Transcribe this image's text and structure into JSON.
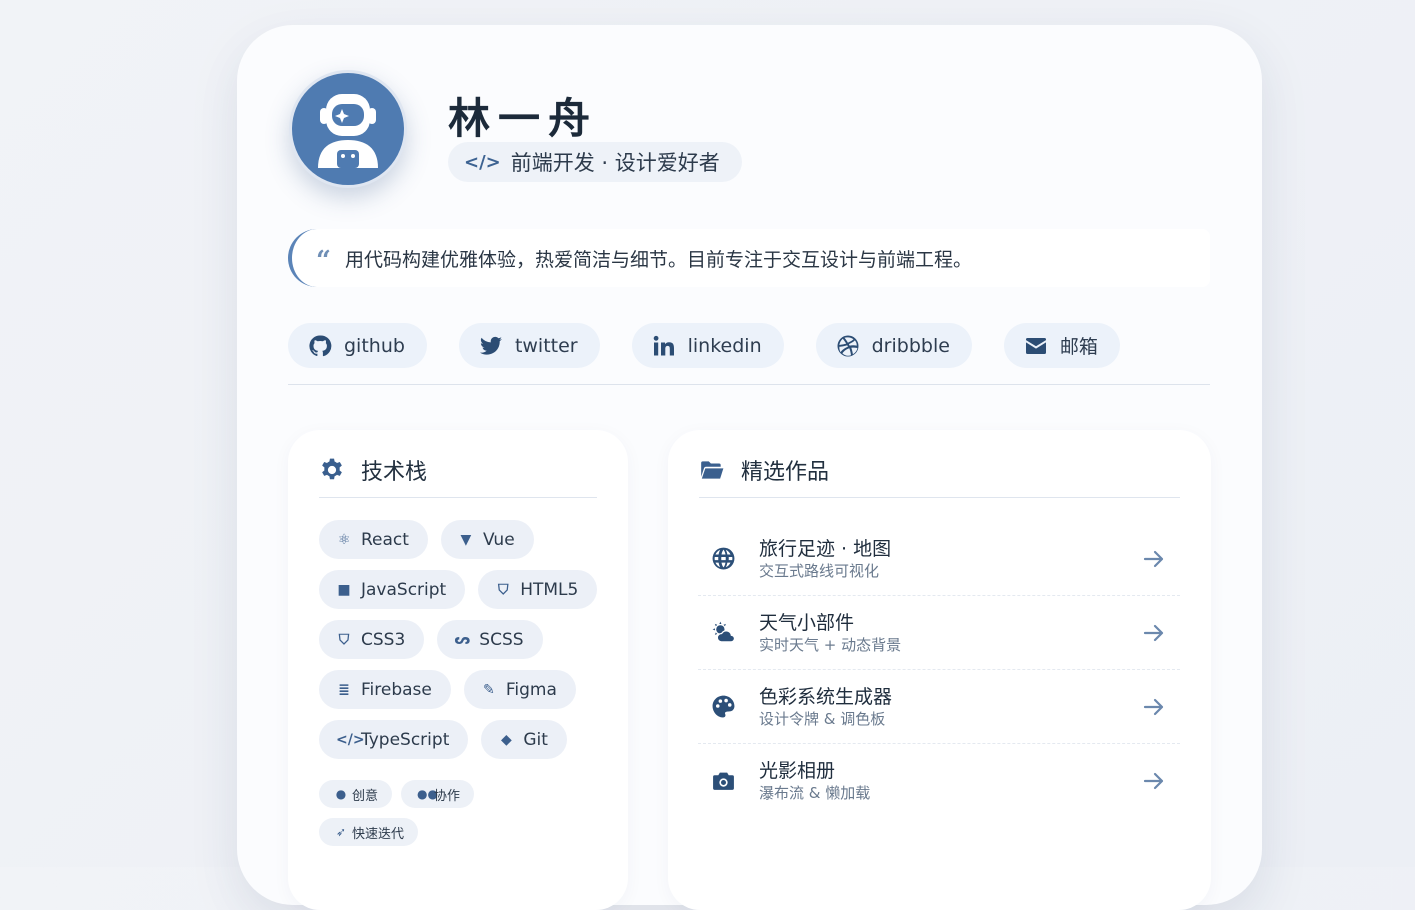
{
  "profile": {
    "name": "林一舟",
    "role": "前端开发 · 设计爱好者",
    "quote": "用代码构建优雅体验，热爱简洁与细节。目前专注于交互设计与前端工程。"
  },
  "socials": [
    {
      "label": "github",
      "icon": "github-icon"
    },
    {
      "label": "twitter",
      "icon": "twitter-icon"
    },
    {
      "label": "linkedin",
      "icon": "linkedin-icon"
    },
    {
      "label": "dribbble",
      "icon": "dribbble-icon"
    },
    {
      "label": "邮箱",
      "icon": "mail-icon"
    }
  ],
  "tech": {
    "title": "技术栈",
    "tags": [
      {
        "label": "React",
        "icon": "react-icon"
      },
      {
        "label": "Vue",
        "icon": "vue-icon"
      },
      {
        "label": "JavaScript",
        "icon": "javascript-icon"
      },
      {
        "label": "HTML5",
        "icon": "html5-icon"
      },
      {
        "label": "CSS3",
        "icon": "css3-icon"
      },
      {
        "label": "SCSS",
        "icon": "sass-icon"
      },
      {
        "label": "Firebase",
        "icon": "database-icon"
      },
      {
        "label": "Figma",
        "icon": "brush-icon"
      },
      {
        "label": "TypeScript",
        "icon": "code-icon"
      },
      {
        "label": "Git",
        "icon": "git-icon"
      }
    ],
    "soft": [
      {
        "label": "创意",
        "icon": "lightbulb-icon"
      },
      {
        "label": "协作",
        "icon": "users-icon"
      },
      {
        "label": "快速迭代",
        "icon": "rocket-icon"
      }
    ]
  },
  "works": {
    "title": "精选作品",
    "items": [
      {
        "title": "旅行足迹 · 地图",
        "desc": "交互式路线可视化",
        "icon": "globe-icon"
      },
      {
        "title": "天气小部件",
        "desc": "实时天气 + 动态背景",
        "icon": "cloud-sun-icon"
      },
      {
        "title": "色彩系统生成器",
        "desc": "设计令牌 & 调色板",
        "icon": "palette-icon"
      },
      {
        "title": "光影相册",
        "desc": "瀑布流 & 懒加载",
        "icon": "camera-icon"
      }
    ]
  },
  "colors": {
    "accent": "#4f7bb1",
    "dark": "#2c4f78"
  }
}
